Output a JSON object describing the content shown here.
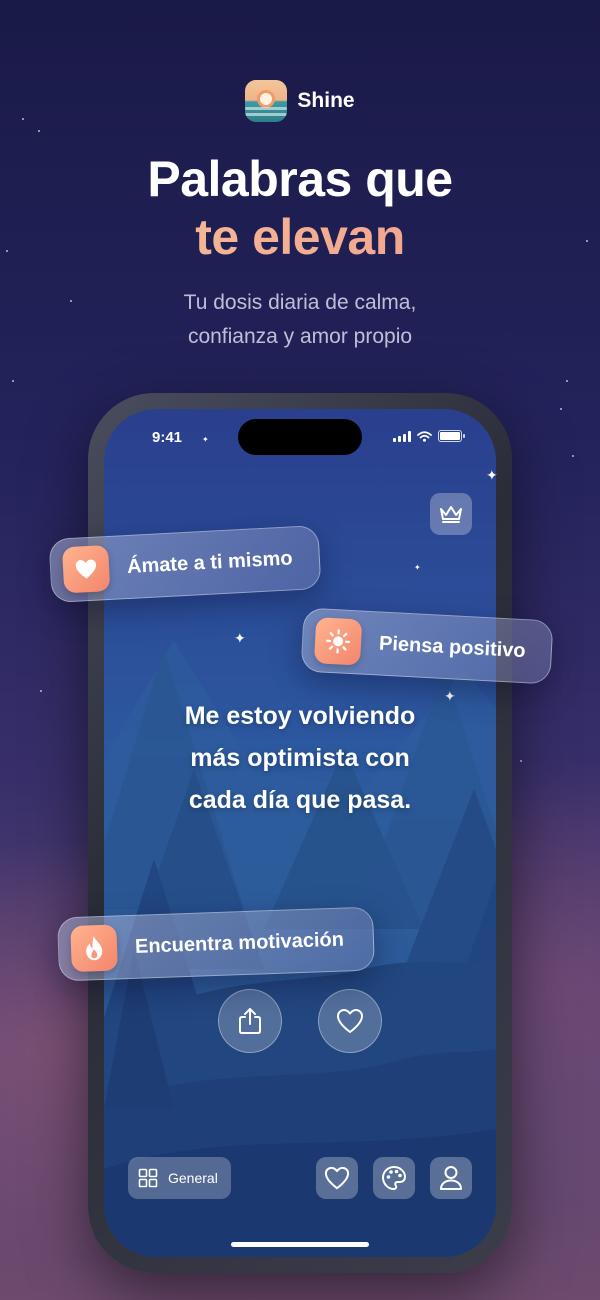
{
  "brand": {
    "name": "Shine"
  },
  "headline": {
    "line1": "Palabras que",
    "line2": "te elevan"
  },
  "subtitle": {
    "line1": "Tu dosis diaria de calma,",
    "line2": "confianza y amor propio"
  },
  "phone": {
    "status": {
      "time": "9:41"
    },
    "quote": {
      "line1": "Me estoy volviendo",
      "line2": "más optimista con",
      "line3": "cada día que pasa."
    },
    "bottom_bar": {
      "category_label": "General"
    }
  },
  "chips": [
    {
      "label": "Ámate a ti mismo",
      "icon": "heart-icon"
    },
    {
      "label": "Piensa positivo",
      "icon": "sun-icon"
    },
    {
      "label": "Encuentra motivación",
      "icon": "flame-icon"
    }
  ],
  "colors": {
    "background_top": "#1a1a48",
    "background_bottom": "#6d4a6e",
    "accent_gradient_start": "#f6c39a",
    "accent_gradient_end": "#f09a8a",
    "chip_icon": "#f3856d",
    "screen": "#2c58a0"
  }
}
